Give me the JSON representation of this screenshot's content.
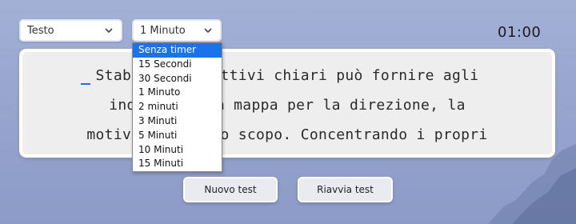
{
  "controls": {
    "mode_select": {
      "value": "Testo",
      "icon": "chevron-down-icon"
    },
    "time_select": {
      "value": "1 Minuto",
      "icon": "chevron-down-icon",
      "options": [
        "Senza timer",
        "15 Secondi",
        "30 Secondi",
        "1 Minuto",
        "2 minuti",
        "3 Minuti",
        "5 Minuti",
        "10 Minuti",
        "15 Minuti"
      ],
      "highlighted_option": "Senza timer"
    }
  },
  "timer": {
    "display": "01:00"
  },
  "typing_text": {
    "lines": [
      "Stabilire obiettivi chiari può fornire agli",
      "individui una mappa per la direzione, la",
      "motivazione e lo scopo. Concentrando i propri"
    ]
  },
  "buttons": {
    "new_test": "Nuovo test",
    "restart_test": "Riavvia test"
  },
  "colors": {
    "background": "#97a5cf",
    "selected_option": "#1a73e8",
    "caret": "#2e6bd9",
    "card": "#eeeeef"
  }
}
